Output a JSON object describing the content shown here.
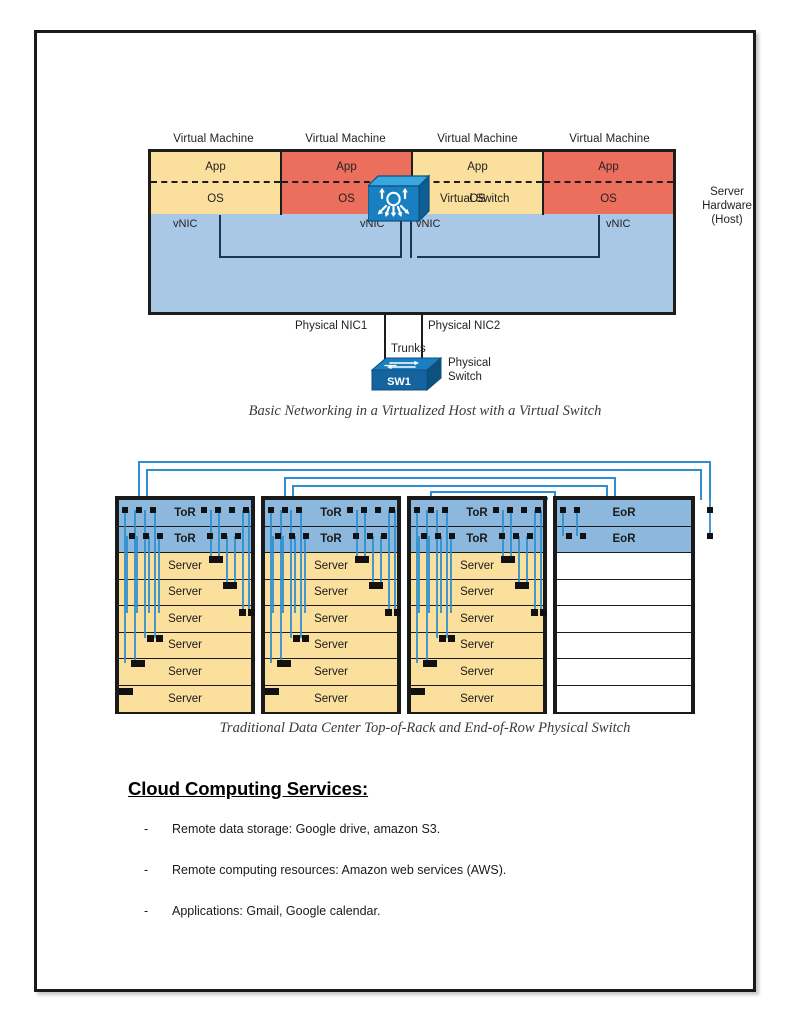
{
  "page": {
    "background": "#ffffff",
    "border_color": "#1a1a1a"
  },
  "figure_virtual_switch": {
    "caption": "Basic Networking in a Virtualized Host with a Virtual Switch",
    "vm_label": "Virtual Machine",
    "vms": [
      {
        "label": "Virtual Machine",
        "app": "App",
        "os": "OS",
        "color": "#fbdf9d",
        "vnic": "vNIC"
      },
      {
        "label": "Virtual Machine",
        "app": "App",
        "os": "OS",
        "color": "#ec6f5e",
        "vnic": "vNIC"
      },
      {
        "label": "Virtual Machine",
        "app": "App",
        "os": "OS",
        "color": "#fbdf9d",
        "vnic": "vNIC"
      },
      {
        "label": "Virtual Machine",
        "app": "App",
        "os": "OS",
        "color": "#ec6f5e",
        "vnic": "vNIC"
      }
    ],
    "host_label": "Server\nHardware\n(Host)",
    "host_label_line1": "Server",
    "host_label_line2": "Hardware",
    "host_label_line3": "(Host)",
    "virtual_switch_label": "Virtual Switch",
    "physical_nic1_label": "Physical NIC1",
    "physical_nic2_label": "Physical NIC2",
    "trunks_label": "Trunks",
    "physical_switch_name": "SW1",
    "physical_switch_label_line1": "Physical",
    "physical_switch_label_line2": "Switch",
    "colors": {
      "host_blue": "#a8c8e6",
      "vm_yellow": "#fbdf9d",
      "vm_red": "#ec6f5e",
      "switch_blue": "#1a7fc1",
      "outline": "#1c1c1c"
    }
  },
  "figure_datacenter": {
    "caption": "Traditional Data Center Top-of-Rack and End-of-Row Physical Switch",
    "racks": [
      {
        "name": "rack-1",
        "rows": [
          "ToR",
          "ToR",
          "Server",
          "Server",
          "Server",
          "Server",
          "Server",
          "Server"
        ],
        "types": [
          "tor",
          "tor",
          "server",
          "server",
          "server",
          "server",
          "server",
          "server"
        ]
      },
      {
        "name": "rack-2",
        "rows": [
          "ToR",
          "ToR",
          "Server",
          "Server",
          "Server",
          "Server",
          "Server",
          "Server"
        ],
        "types": [
          "tor",
          "tor",
          "server",
          "server",
          "server",
          "server",
          "server",
          "server"
        ]
      },
      {
        "name": "rack-3",
        "rows": [
          "ToR",
          "ToR",
          "Server",
          "Server",
          "Server",
          "Server",
          "Server",
          "Server"
        ],
        "types": [
          "tor",
          "tor",
          "server",
          "server",
          "server",
          "server",
          "server",
          "server"
        ]
      },
      {
        "name": "rack-eor",
        "rows": [
          "EoR",
          "EoR",
          "",
          "",
          "",
          "",
          "",
          ""
        ],
        "types": [
          "tor",
          "tor",
          "empty",
          "empty",
          "empty",
          "empty",
          "empty",
          "empty"
        ]
      }
    ],
    "colors": {
      "tor_blue": "#8db8dd",
      "server_yellow": "#fbdf9d",
      "cable_blue": "#2f8fd0",
      "port_black": "#111111",
      "outline": "#1a1a1a"
    }
  },
  "cloud_section": {
    "heading": "Cloud Computing Services:",
    "bullet_marker": "-",
    "items": [
      "Remote data storage: Google drive, amazon S3.",
      "Remote computing resources: Amazon web services (AWS).",
      "Applications: Gmail, Google calendar."
    ]
  }
}
